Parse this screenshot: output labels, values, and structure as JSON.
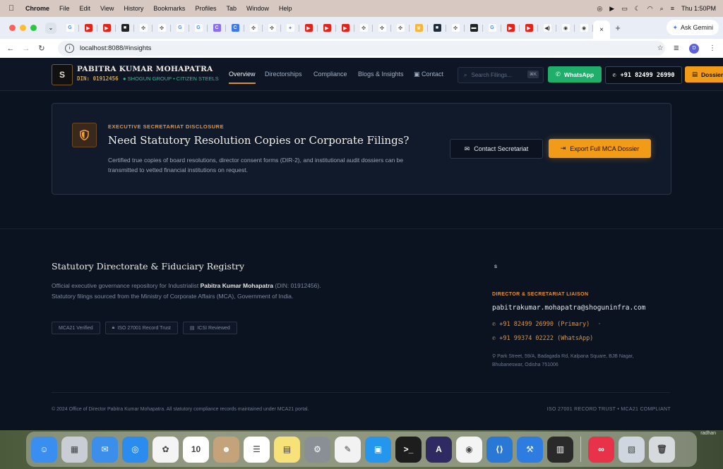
{
  "menubar": {
    "app": "Chrome",
    "items": [
      "File",
      "Edit",
      "View",
      "History",
      "Bookmarks",
      "Profiles",
      "Tab",
      "Window",
      "Help"
    ],
    "clock": "Thu 1:50PM"
  },
  "tabs": {
    "favicons": [
      {
        "label": "G",
        "color": "#ffffff",
        "fg": "#4285f4"
      },
      {
        "label": "▶",
        "color": "#e62117",
        "fg": "#fff"
      },
      {
        "label": "▶",
        "color": "#e62117",
        "fg": "#fff"
      },
      {
        "label": "■",
        "color": "#222",
        "fg": "#fff"
      },
      {
        "label": "✣",
        "color": "#ffffff",
        "fg": "#222"
      },
      {
        "label": "✣",
        "color": "#ffffff",
        "fg": "#222"
      },
      {
        "label": "G",
        "color": "#ffffff",
        "fg": "#4285f4"
      },
      {
        "label": "G",
        "color": "#ffffff",
        "fg": "#4285f4"
      },
      {
        "label": "C",
        "color": "#8a6df0",
        "fg": "#fff"
      },
      {
        "label": "C",
        "color": "#3a78f2",
        "fg": "#fff"
      },
      {
        "label": "✣",
        "color": "#ffffff",
        "fg": "#222"
      },
      {
        "label": "✣",
        "color": "#ffffff",
        "fg": "#222"
      },
      {
        "label": "✦",
        "color": "#ffffff",
        "fg": "#4a7cf0"
      },
      {
        "label": "▶",
        "color": "#e62117",
        "fg": "#fff"
      },
      {
        "label": "▶",
        "color": "#e62117",
        "fg": "#fff"
      },
      {
        "label": "▶",
        "color": "#e62117",
        "fg": "#fff"
      },
      {
        "label": "✣",
        "color": "#ffffff",
        "fg": "#222"
      },
      {
        "label": "✣",
        "color": "#ffffff",
        "fg": "#222"
      },
      {
        "label": "✣",
        "color": "#ffffff",
        "fg": "#222"
      },
      {
        "label": "♛",
        "color": "#f3b73c",
        "fg": "#fff"
      },
      {
        "label": "■",
        "color": "#1d2b3a",
        "fg": "#fff"
      },
      {
        "label": "✣",
        "color": "#ffffff",
        "fg": "#222"
      },
      {
        "label": "▬",
        "color": "#222",
        "fg": "#fff"
      },
      {
        "label": "G",
        "color": "#ffffff",
        "fg": "#4285f4"
      },
      {
        "label": "▶",
        "color": "#e62117",
        "fg": "#fff"
      },
      {
        "label": "▶",
        "color": "#e62117",
        "fg": "#fff"
      },
      {
        "label": "◀)",
        "color": "#ffffff",
        "fg": "#333"
      },
      {
        "label": "◉",
        "color": "#ffffff",
        "fg": "#333"
      },
      {
        "label": "◉",
        "color": "#ffffff",
        "fg": "#333"
      }
    ],
    "active_close": "×",
    "new_tab": "+",
    "gemini": "Ask Gemini"
  },
  "address": {
    "url": "localhost:8088/#insights",
    "profile": "D"
  },
  "site": {
    "brand_name": "PABITRA KUMAR MOHAPATRA",
    "brand_din": "DIN: 01912456",
    "brand_group": "● SHOGUN GROUP • CITIZEN STEELS",
    "logo": "S",
    "nav": [
      "Overview",
      "Directorships",
      "Compliance",
      "Blogs & Insights",
      "Contact"
    ],
    "search_placeholder": "Search Filings...",
    "search_kbd": "⌘K",
    "whatsapp": "WhatsApp",
    "phone": "+91 82499 26990",
    "dossier": "Dossier"
  },
  "disclosure": {
    "eyebrow": "EXECUTIVE SECRETARIAT DISCLOSURE",
    "title": "Need Statutory Resolution Copies or Corporate Filings?",
    "desc": "Certified true copies of board resolutions, director consent forms (DIR-2), and institutional audit dossiers can be transmitted to vetted financial institutions on request.",
    "contact_btn": "Contact Secretariat",
    "export_btn": "Export Full MCA Dossier"
  },
  "footer": {
    "title": "Statutory Directorate & Fiduciary Registry",
    "desc_pre": "Official executive governance repository for Industrialist ",
    "desc_name": "Pabitra Kumar Mohapatra",
    "desc_post": " (DIN: 01912456). Statutory filings sourced from the Ministry of Corporate Affairs (MCA), Government of India.",
    "badges": [
      "MCA21 Verified",
      "ISO 27001 Record Trust",
      "ICSI Reviewed"
    ],
    "logo": "S",
    "liaison": "DIRECTOR & SECRETARIAT LIAISON",
    "email": "pabitrakumar.mohapatra@shoguninfra.com",
    "phone_primary": "+91 82499 26990 (Primary)",
    "phone_dot": "·",
    "phone_whatsapp": "+91 99374 02222 (WhatsApp)",
    "address": "Park Street, 59/A, Badagada Rd, Kalpana Square, BJB Nagar, Bhubaneswar, Odisha 751006",
    "copyright": "© 2024 Office of Director Pabitra Kumar Mohapatra. All statutory compliance records maintained under MCA21 portal.",
    "iso": "ISO 27001 RECORD TRUST • MCA21 COMPLIANT"
  },
  "dock": {
    "apps": [
      {
        "name": "finder",
        "label": "☺",
        "color": "#3a8ef0"
      },
      {
        "name": "launchpad",
        "label": "▦",
        "color": "#c9ced6"
      },
      {
        "name": "mail",
        "label": "✉",
        "color": "#3b8eea"
      },
      {
        "name": "safari",
        "label": "◎",
        "color": "#2b8cf0"
      },
      {
        "name": "photos",
        "label": "✿",
        "color": "#f4f4f4"
      },
      {
        "name": "calendar",
        "label": "10",
        "color": "#ffffff"
      },
      {
        "name": "contacts",
        "label": "☻",
        "color": "#c4a27a"
      },
      {
        "name": "reminders",
        "label": "☰",
        "color": "#ffffff"
      },
      {
        "name": "notes",
        "label": "▤",
        "color": "#f7e27a"
      },
      {
        "name": "settings",
        "label": "⚙",
        "color": "#8a8f96"
      },
      {
        "name": "textedit",
        "label": "✎",
        "color": "#f2f2f2"
      },
      {
        "name": "docker",
        "label": "▣",
        "color": "#2496ed"
      },
      {
        "name": "terminal",
        "label": ">_",
        "color": "#1d1d1d"
      },
      {
        "name": "arc",
        "label": "A",
        "color": "#2f2a62"
      },
      {
        "name": "chrome",
        "label": "◉",
        "color": "#f4f4f4"
      },
      {
        "name": "vscode",
        "label": "⟨⟩",
        "color": "#2a78d6"
      },
      {
        "name": "xcode",
        "label": "⚒",
        "color": "#2d7de0"
      },
      {
        "name": "console",
        "label": "▥",
        "color": "#2a2a2a"
      }
    ],
    "apps_right": [
      {
        "name": "creative-cloud",
        "label": "∞",
        "color": "#e8324a"
      },
      {
        "name": "preview",
        "label": "▧",
        "color": "#cfd6df"
      },
      {
        "name": "trash",
        "label": "🗑",
        "color": "#d7dadd"
      }
    ],
    "user_label": "radhan",
    "calendar_month": "SEP"
  }
}
